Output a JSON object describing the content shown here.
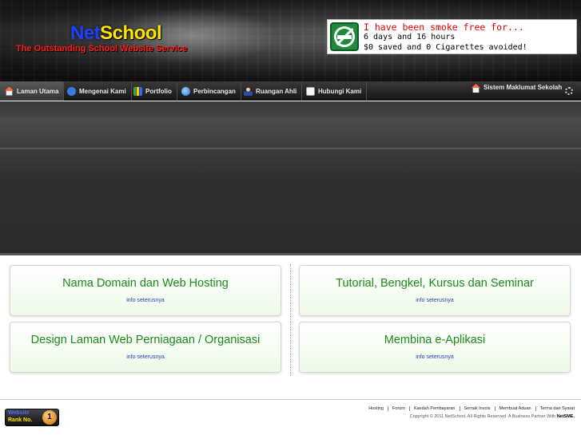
{
  "header": {
    "logo_net": "Net",
    "logo_school": "School",
    "tagline": "The Outstanding School Website Service"
  },
  "smoke_widget": {
    "line1": "I have been smoke free for...",
    "line2": "6 days and 16 hours",
    "line3": "$0 saved and 0 Cigarettes avoided!"
  },
  "nav": {
    "items": [
      {
        "label": "Laman Utama",
        "icon": "home-icon"
      },
      {
        "label": "Mengenai Kami",
        "icon": "info-icon"
      },
      {
        "label": "Portfolio",
        "icon": "chart-icon"
      },
      {
        "label": "Perbincangan",
        "icon": "globe-icon"
      },
      {
        "label": "Ruangan Ahli",
        "icon": "user-icon"
      },
      {
        "label": "Hubungi Kami",
        "icon": "mail-icon"
      }
    ],
    "right_item": {
      "label": "Sistem Maklumat Sekolah",
      "icon": "home-icon"
    }
  },
  "boxes": [
    {
      "title": "Nama Domain dan Web Hosting",
      "link": "info seterusnya"
    },
    {
      "title": "Tutorial, Bengkel, Kursus dan Seminar",
      "link": "info seterusnya"
    },
    {
      "title": "Design Laman Web Perniagaan / Organisasi",
      "link": "info seterusnya"
    },
    {
      "title": "Membina e-Aplikasi",
      "link": "info seterusnya"
    }
  ],
  "footer": {
    "rank_line1": "Website",
    "rank_line2": "Rank No.",
    "rank_number": "1",
    "links": [
      "Hosting",
      "Forum",
      "Kaedah Pembayaran",
      "Semak Invois",
      "Membuat Aduan",
      "Terma dan Syarat"
    ],
    "copyright": "Copyright © 2011 NetSchool. All Rights Reserved. A Business Partner With ",
    "partner": "NetSME."
  }
}
